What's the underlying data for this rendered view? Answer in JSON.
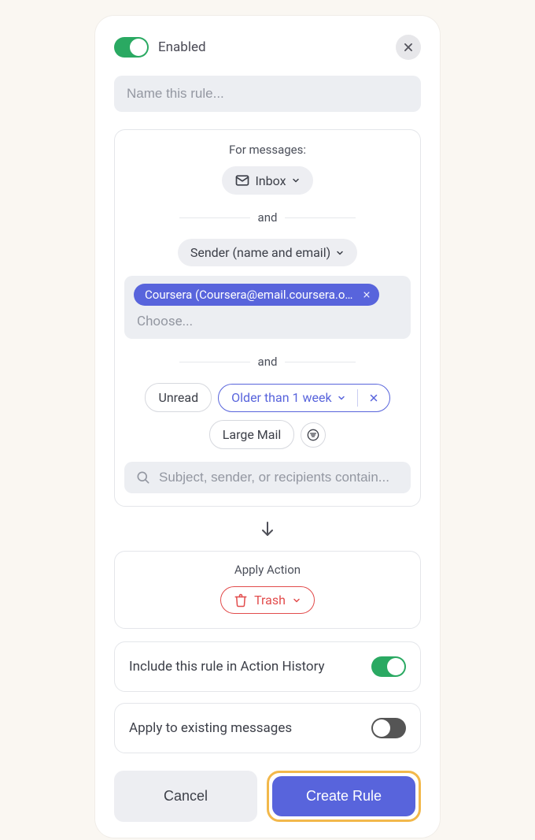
{
  "header": {
    "enabled_label": "Enabled",
    "enabled_state": true
  },
  "name_input": {
    "placeholder": "Name this rule..."
  },
  "conditions": {
    "title": "For messages:",
    "mailbox": {
      "label": "Inbox"
    },
    "and_label": "and",
    "sender_filter": {
      "label": "Sender (name and email)",
      "chip": "Coursera (Coursera@email.coursera.o…",
      "choose_placeholder": "Choose..."
    },
    "status_filters": {
      "unread_label": "Unread",
      "older_label": "Older than 1 week",
      "large_label": "Large Mail"
    },
    "search": {
      "placeholder": "Subject, sender, or recipients contain..."
    }
  },
  "action": {
    "title": "Apply Action",
    "trash_label": "Trash"
  },
  "options": {
    "history_label": "Include this rule in Action History",
    "history_state": true,
    "existing_label": "Apply to existing messages",
    "existing_state": false
  },
  "footer": {
    "cancel_label": "Cancel",
    "create_label": "Create Rule"
  }
}
